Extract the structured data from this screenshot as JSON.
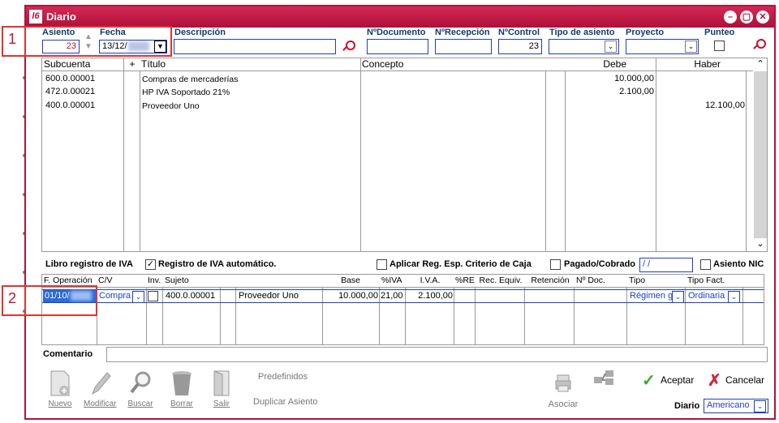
{
  "window": {
    "title": "Diario",
    "app_icon_text": "l6"
  },
  "annotations": {
    "box1": "1",
    "box2": "2"
  },
  "header": {
    "asiento_label": "Asiento",
    "asiento_value": "23",
    "fecha_label": "Fecha",
    "fecha_value": "13/12/",
    "descripcion_label": "Descripción",
    "descripcion_value": "",
    "ndocumento_label": "NºDocumento",
    "ndocumento_value": "",
    "nrecepcion_label": "NºRecepción",
    "nrecepcion_value": "",
    "ncontrol_label": "NºControl",
    "ncontrol_value": "23",
    "tipo_asiento_label": "Tipo de asiento",
    "tipo_asiento_value": "",
    "proyecto_label": "Proyecto",
    "proyecto_value": "",
    "punteo_label": "Punteo"
  },
  "ledger": {
    "columns": [
      "Subcuenta",
      "+",
      "Título",
      "Concepto",
      "Debe",
      "Haber"
    ],
    "rows": [
      {
        "subcuenta": "600.0.00001",
        "titulo": "Compras de mercaderías",
        "concepto": "",
        "debe": "10.000,00",
        "haber": ""
      },
      {
        "subcuenta": "472.0.00021",
        "titulo": "HP IVA Soportado 21%",
        "concepto": "",
        "debe": "2.100,00",
        "haber": ""
      },
      {
        "subcuenta": "400.0.00001",
        "titulo": "Proveedor Uno",
        "concepto": "",
        "debe": "",
        "haber": "12.100,00"
      }
    ]
  },
  "iva": {
    "section_label": "Libro registro de IVA",
    "auto_label": "Registro de IVA automático.",
    "auto_checked": "✓",
    "criterio_caja_label": "Aplicar Reg. Esp. Criterio de Caja",
    "pagado_label": "Pagado/Cobrado",
    "pagado_value": " / /",
    "asiento_nic_label": "Asiento NIC",
    "columns": [
      "F. Operación",
      "C/V",
      "Inv.",
      "Sujeto",
      "",
      "",
      "Base",
      "%IVA",
      "I.V.A.",
      "%RE",
      "Rec. Equiv.",
      "Retención",
      "Nº Doc.",
      "Tipo",
      "Tipo Fact."
    ],
    "row": {
      "f_operacion": "01/10/",
      "cv": "Compra",
      "sujeto": "400.0.00001",
      "nombre": "Proveedor Uno",
      "base": "10.000,00",
      "piva": "21,00",
      "iva": "2.100,00",
      "tipo": "Régimen g",
      "tipo_fact": "Ordinaria"
    }
  },
  "comentario": {
    "label": "Comentario",
    "value": ""
  },
  "toolbar": {
    "nuevo": "Nuevo",
    "modificar": "Modificar",
    "buscar": "Buscar",
    "borrar": "Borrar",
    "salir": "Salir",
    "predefinidos": "Predefinidos",
    "duplicar": "Duplicar Asiento",
    "asociar": "Asociar",
    "aceptar": "Aceptar",
    "cancelar": "Cancelar"
  },
  "footer": {
    "diario_label": "Diario",
    "diario_value": "Americano"
  }
}
